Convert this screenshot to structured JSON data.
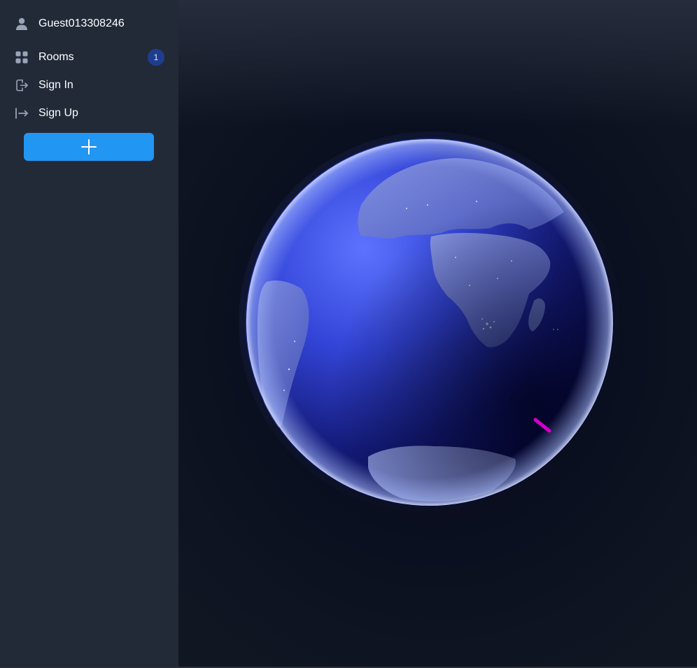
{
  "sidebar": {
    "user": {
      "name": "Guest013308246",
      "icon": "user-icon"
    },
    "items": [
      {
        "label": "Rooms",
        "icon": "grid-icon",
        "badge": "1"
      },
      {
        "label": "Sign In",
        "icon": "sign-in-icon"
      },
      {
        "label": "Sign Up",
        "icon": "sign-up-icon"
      }
    ],
    "add_button": {
      "icon": "plus-icon",
      "color": "#2196f3"
    }
  },
  "viewport": {
    "content": "globe",
    "marker_color": "#d400c8"
  },
  "colors": {
    "sidebar_bg": "#222a38",
    "badge_bg": "#1f3d8f",
    "globe_ocean": "#3a4fe0",
    "globe_land": "#6f7fc9"
  }
}
